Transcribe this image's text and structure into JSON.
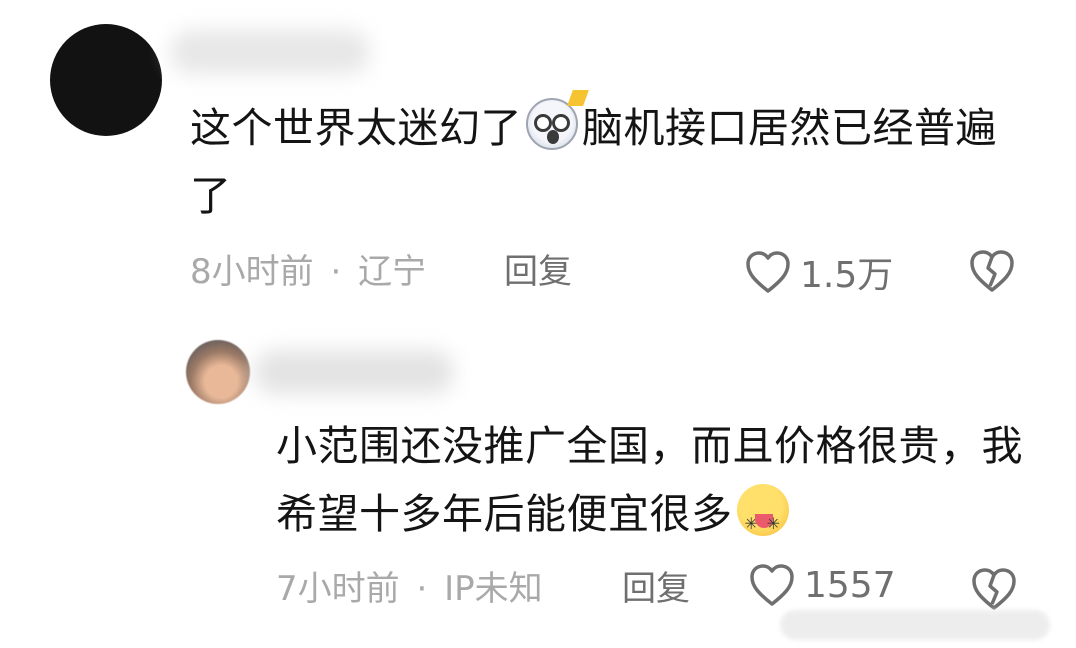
{
  "comments": [
    {
      "text_part1": "这个世界太迷幻了",
      "emoji": "shocked-face-emoji",
      "text_part2": "脑机接口居然已经普遍了",
      "time": "8小时前",
      "separator": "·",
      "location": "辽宁",
      "reply_label": "回复",
      "likes": "1.5万"
    },
    {
      "text_part1": "小范围还没推广全国，而且价格很贵，我希望十多年后能便宜很多",
      "emoji": "crazy-tongue-face-emoji",
      "time": "7小时前",
      "separator": "·",
      "location": "IP未知",
      "reply_label": "回复",
      "likes": "1557"
    }
  ],
  "icons": {
    "like": "heart-outline-icon",
    "dislike": "broken-heart-icon"
  },
  "colors": {
    "text": "#141414",
    "meta": "#a9a9a9",
    "action": "#6f6f6f"
  }
}
